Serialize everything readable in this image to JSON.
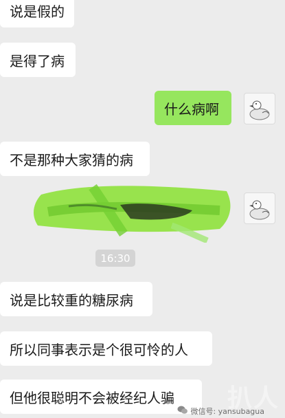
{
  "messages": [
    {
      "text": "说是假的"
    },
    {
      "text": "是得了病"
    },
    {
      "text": "什么病啊"
    },
    {
      "text": "不是那种大家猜的病"
    },
    {
      "text": "说是比较重的糖尿病"
    },
    {
      "text": "所以同事表示是个很可怜的人"
    },
    {
      "text": "但他很聪明不会被经纪人骗"
    }
  ],
  "timestamp": "16:30",
  "watermark": {
    "text": "微信号: yansubagua",
    "big_text": "扒人"
  },
  "colors": {
    "sent_bubble": "#96e65e",
    "received_bubble": "#ffffff",
    "background": "#ececec",
    "redaction_scribble": "#8fe23c"
  },
  "icons": {
    "avatar": "duck-avatar-icon",
    "wechat": "wechat-icon"
  }
}
